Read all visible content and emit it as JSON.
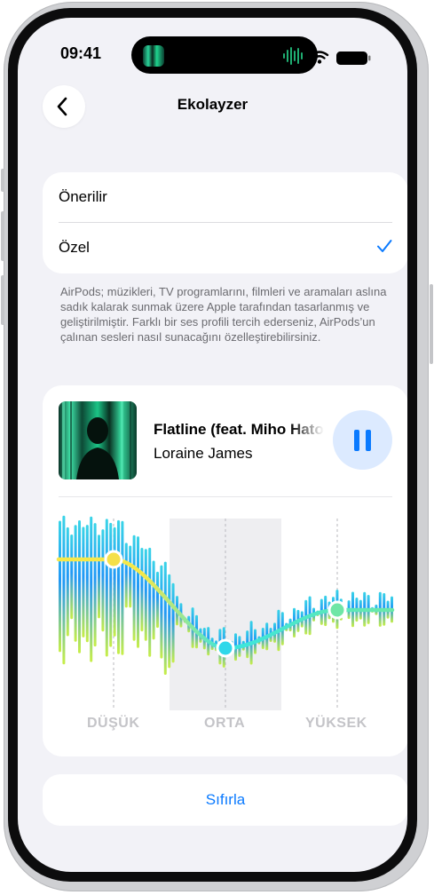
{
  "status_bar": {
    "time": "09:41"
  },
  "nav": {
    "title": "Ekolayzer",
    "back_icon": "chevron-left-icon"
  },
  "options": [
    {
      "label": "Önerilir",
      "selected": false
    },
    {
      "label": "Özel",
      "selected": true
    }
  ],
  "description": "AirPods; müzikleri, TV programlarını, filmleri ve aramaları aslına sadık kalarak sunmak üzere Apple tarafından tasarlanmış ve geliştirilmiştir. Farklı bir ses profili tercih ederseniz, AirPods’un çalınan sesleri nasıl sunacağını özelleştirebilirsiniz.",
  "player": {
    "title": "Flatline (feat. Miho Hatori)",
    "title_visible": "Flatline (feat. Miho Ha",
    "artist": "Loraine James",
    "state": "playing",
    "pause_icon": "pause-icon"
  },
  "equalizer": {
    "bands": [
      {
        "label": "DÜŞÜK"
      },
      {
        "label": "ORTA"
      },
      {
        "label": "YÜKSEK"
      }
    ],
    "highlighted_band": "ORTA",
    "colors": {
      "curve": [
        "#f5e84a",
        "#39e6e0",
        "#6be8a8"
      ],
      "bars": [
        "#c6ee3c",
        "#2fd2e6",
        "#1593f5"
      ]
    }
  },
  "reset": {
    "label": "Sıfırla"
  },
  "colors": {
    "accent": "#0a7aff",
    "background": "#f2f2f7",
    "card": "#ffffff"
  }
}
